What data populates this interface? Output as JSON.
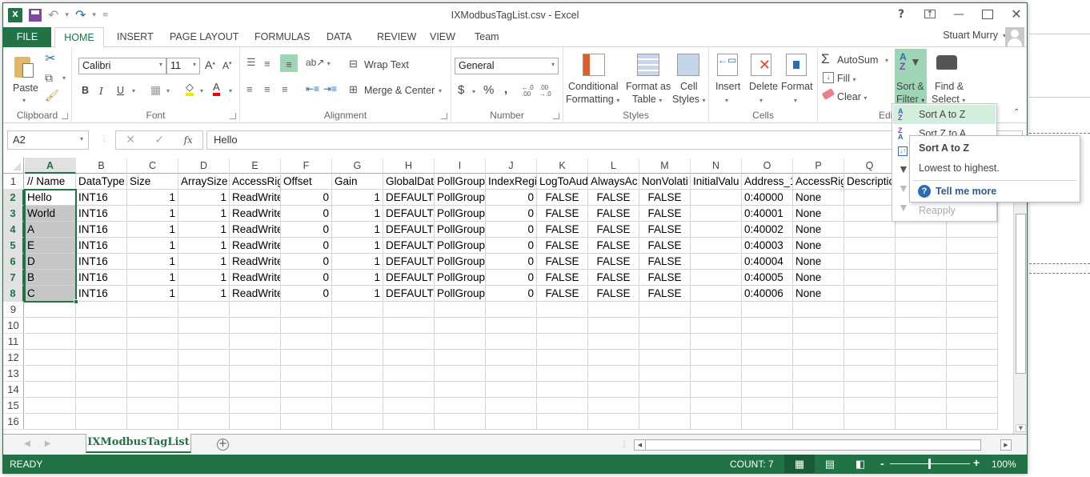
{
  "window": {
    "title": "IXModbusTagList.csv - Excel",
    "controls": [
      "?",
      "ribbon-display",
      "minimize",
      "maximize",
      "close"
    ]
  },
  "qat": {
    "app_icon": "X",
    "save": "save-icon",
    "undo": "undo-icon",
    "redo": "redo-icon"
  },
  "tabs": [
    "FILE",
    "HOME",
    "INSERT",
    "PAGE LAYOUT",
    "FORMULAS",
    "DATA",
    "REVIEW",
    "VIEW",
    "Team"
  ],
  "user": {
    "name": "Stuart Murry"
  },
  "ribbon": {
    "clipboard": {
      "label": "Clipboard",
      "paste": "Paste"
    },
    "font": {
      "label": "Font",
      "font_name": "Calibri",
      "font_size": "11",
      "bold": "B",
      "italic": "I",
      "underline": "U"
    },
    "alignment": {
      "label": "Alignment",
      "wrap_text": "Wrap Text",
      "merge_center": "Merge & Center"
    },
    "number": {
      "label": "Number",
      "format": "General",
      "currency": "$",
      "percent": "%",
      "comma": ",",
      "inc_decimal": "←.0 .00",
      "dec_decimal": ".00 →.0"
    },
    "styles": {
      "label": "Styles",
      "conditional_1": "Conditional",
      "conditional_2": "Formatting",
      "format_table_1": "Format as",
      "format_table_2": "Table",
      "cell_styles_1": "Cell",
      "cell_styles_2": "Styles"
    },
    "cells": {
      "label": "Cells",
      "insert": "Insert",
      "delete": "Delete",
      "format": "Format"
    },
    "editing": {
      "label": "Editi",
      "autosum": "AutoSum",
      "fill": "Fill",
      "clear": "Clear",
      "sort_filter_1": "Sort &",
      "sort_filter_2": "Filter",
      "find_select_1": "Find &",
      "find_select_2": "Select"
    }
  },
  "formula_bar": {
    "name_box": "A2",
    "value": "Hello",
    "fx": "fx"
  },
  "sheet": {
    "columns": [
      "A",
      "B",
      "C",
      "D",
      "E",
      "F",
      "G",
      "H",
      "I",
      "J",
      "K",
      "L",
      "M",
      "N",
      "O",
      "P",
      "Q"
    ],
    "selected_column": "A",
    "row_numbers": [
      "1",
      "2",
      "3",
      "4",
      "5",
      "6",
      "7",
      "8",
      "9",
      "10",
      "11",
      "12",
      "13",
      "14",
      "15",
      "16"
    ],
    "header_row": [
      "// Name",
      "DataType",
      "Size",
      "ArraySize",
      "AccessRig",
      "Offset",
      "Gain",
      "GlobalDat",
      "PollGroup",
      "IndexRegi",
      "LogToAud",
      "AlwaysAc",
      "NonVolati",
      "InitialValu",
      "Address_1",
      "AccessRig",
      "Descriptio"
    ],
    "rows": [
      [
        "Hello",
        "INT16",
        "1",
        "1",
        "ReadWrite",
        "0",
        "1",
        "DEFAULT",
        "PollGroup",
        "0",
        "FALSE",
        "FALSE",
        "FALSE",
        "",
        "0:40000",
        "None",
        ""
      ],
      [
        "World",
        "INT16",
        "1",
        "1",
        "ReadWrite",
        "0",
        "1",
        "DEFAULT",
        "PollGroup",
        "0",
        "FALSE",
        "FALSE",
        "FALSE",
        "",
        "0:40001",
        "None",
        ""
      ],
      [
        "A",
        "INT16",
        "1",
        "1",
        "ReadWrite",
        "0",
        "1",
        "DEFAULT",
        "PollGroup",
        "0",
        "FALSE",
        "FALSE",
        "FALSE",
        "",
        "0:40002",
        "None",
        ""
      ],
      [
        "E",
        "INT16",
        "1",
        "1",
        "ReadWrite",
        "0",
        "1",
        "DEFAULT",
        "PollGroup",
        "0",
        "FALSE",
        "FALSE",
        "FALSE",
        "",
        "0:40003",
        "None",
        ""
      ],
      [
        "D",
        "INT16",
        "1",
        "1",
        "ReadWrite",
        "0",
        "1",
        "DEFAULT",
        "PollGroup",
        "0",
        "FALSE",
        "FALSE",
        "FALSE",
        "",
        "0:40004",
        "None",
        ""
      ],
      [
        "B",
        "INT16",
        "1",
        "1",
        "ReadWrite",
        "0",
        "1",
        "DEFAULT",
        "PollGroup",
        "0",
        "FALSE",
        "FALSE",
        "FALSE",
        "",
        "0:40005",
        "None",
        ""
      ],
      [
        "C",
        "INT16",
        "1",
        "1",
        "ReadWrite",
        "0",
        "1",
        "DEFAULT",
        "PollGroup",
        "0",
        "FALSE",
        "FALSE",
        "FALSE",
        "",
        "0:40006",
        "None",
        ""
      ]
    ],
    "active_sheet": "IXModbusTagList"
  },
  "sort_menu": {
    "items": [
      {
        "label": "Sort A to Z",
        "state": "highlighted"
      },
      {
        "label": "Sort Z to A",
        "state": "normal"
      },
      {
        "label": "Custom Sort...",
        "state": "normal"
      },
      {
        "label": "Filter",
        "state": "normal"
      },
      {
        "label": "Clear",
        "state": "disabled"
      },
      {
        "label": "Reapply",
        "state": "disabled"
      }
    ]
  },
  "tooltip": {
    "title": "Sort A to Z",
    "description": "Lowest to highest.",
    "help": "Tell me more"
  },
  "status": {
    "ready": "READY",
    "count": "COUNT: 7",
    "zoom": "100%"
  }
}
